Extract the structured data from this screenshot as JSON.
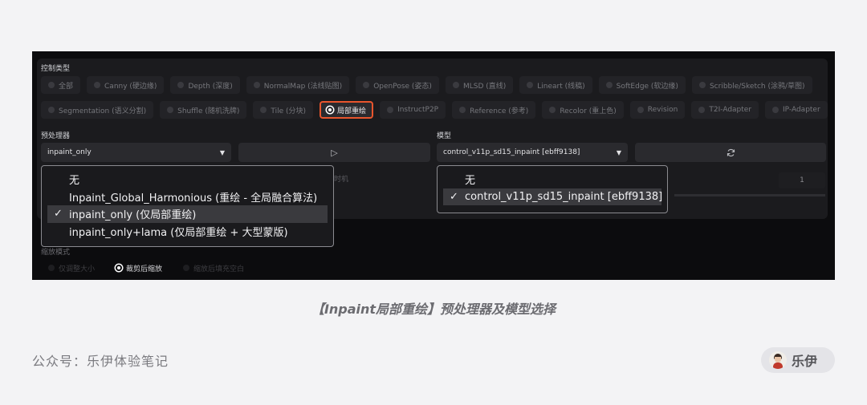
{
  "control_type_label": "控制类型",
  "control_types_row1": [
    "全部",
    "Canny (硬边缘)",
    "Depth (深度)",
    "NormalMap (法线贴图)",
    "OpenPose (姿态)",
    "MLSD (直线)",
    "Lineart (线稿)",
    "SoftEdge (软边缘)",
    "Scribble/Sketch (涂鸦/草图)"
  ],
  "control_types_row2": [
    "Segmentation (语义分割)",
    "Shuffle (随机洗牌)",
    "Tile (分块)",
    "局部重绘",
    "InstructP2P",
    "Reference (参考)",
    "Recolor (重上色)",
    "Revision",
    "T2I-Adapter",
    "IP-Adapter"
  ],
  "selected_control_type": "局部重绘",
  "preprocessor": {
    "label": "预处理器",
    "value": "inpaint_only",
    "run_icon": "▷",
    "options": [
      "无",
      "Inpaint_Global_Harmonious (重绘 - 全局融合算法)",
      "inpaint_only (仅局部重绘)",
      "inpaint_only+lama (仅局部重绘 + 大型蒙版)"
    ],
    "selected_index": 2
  },
  "model": {
    "label": "模型",
    "value": "control_v11p_sd15_inpaint [ebff9138]",
    "refresh_icon": "🔄",
    "options": [
      "无",
      "control_v11p_sd15_inpaint [ebff9138]"
    ],
    "selected_index": 1
  },
  "check_mark": "✓",
  "obscured_timing_text": "时机",
  "number_value": "1",
  "resize_mode": {
    "label": "缩放模式",
    "options": [
      "仅调整大小",
      "裁剪后缩放",
      "缩放后填充空白"
    ],
    "selected": "裁剪后缩放"
  },
  "caption": "【Inpaint局部重绘】预处理器及模型选择",
  "footer_left": "公众号：乐伊体验笔记",
  "author_name": "乐伊",
  "colors": {
    "accent": "#e8552d",
    "panel": "#1b1b1e",
    "page": "#f3f3f5"
  }
}
